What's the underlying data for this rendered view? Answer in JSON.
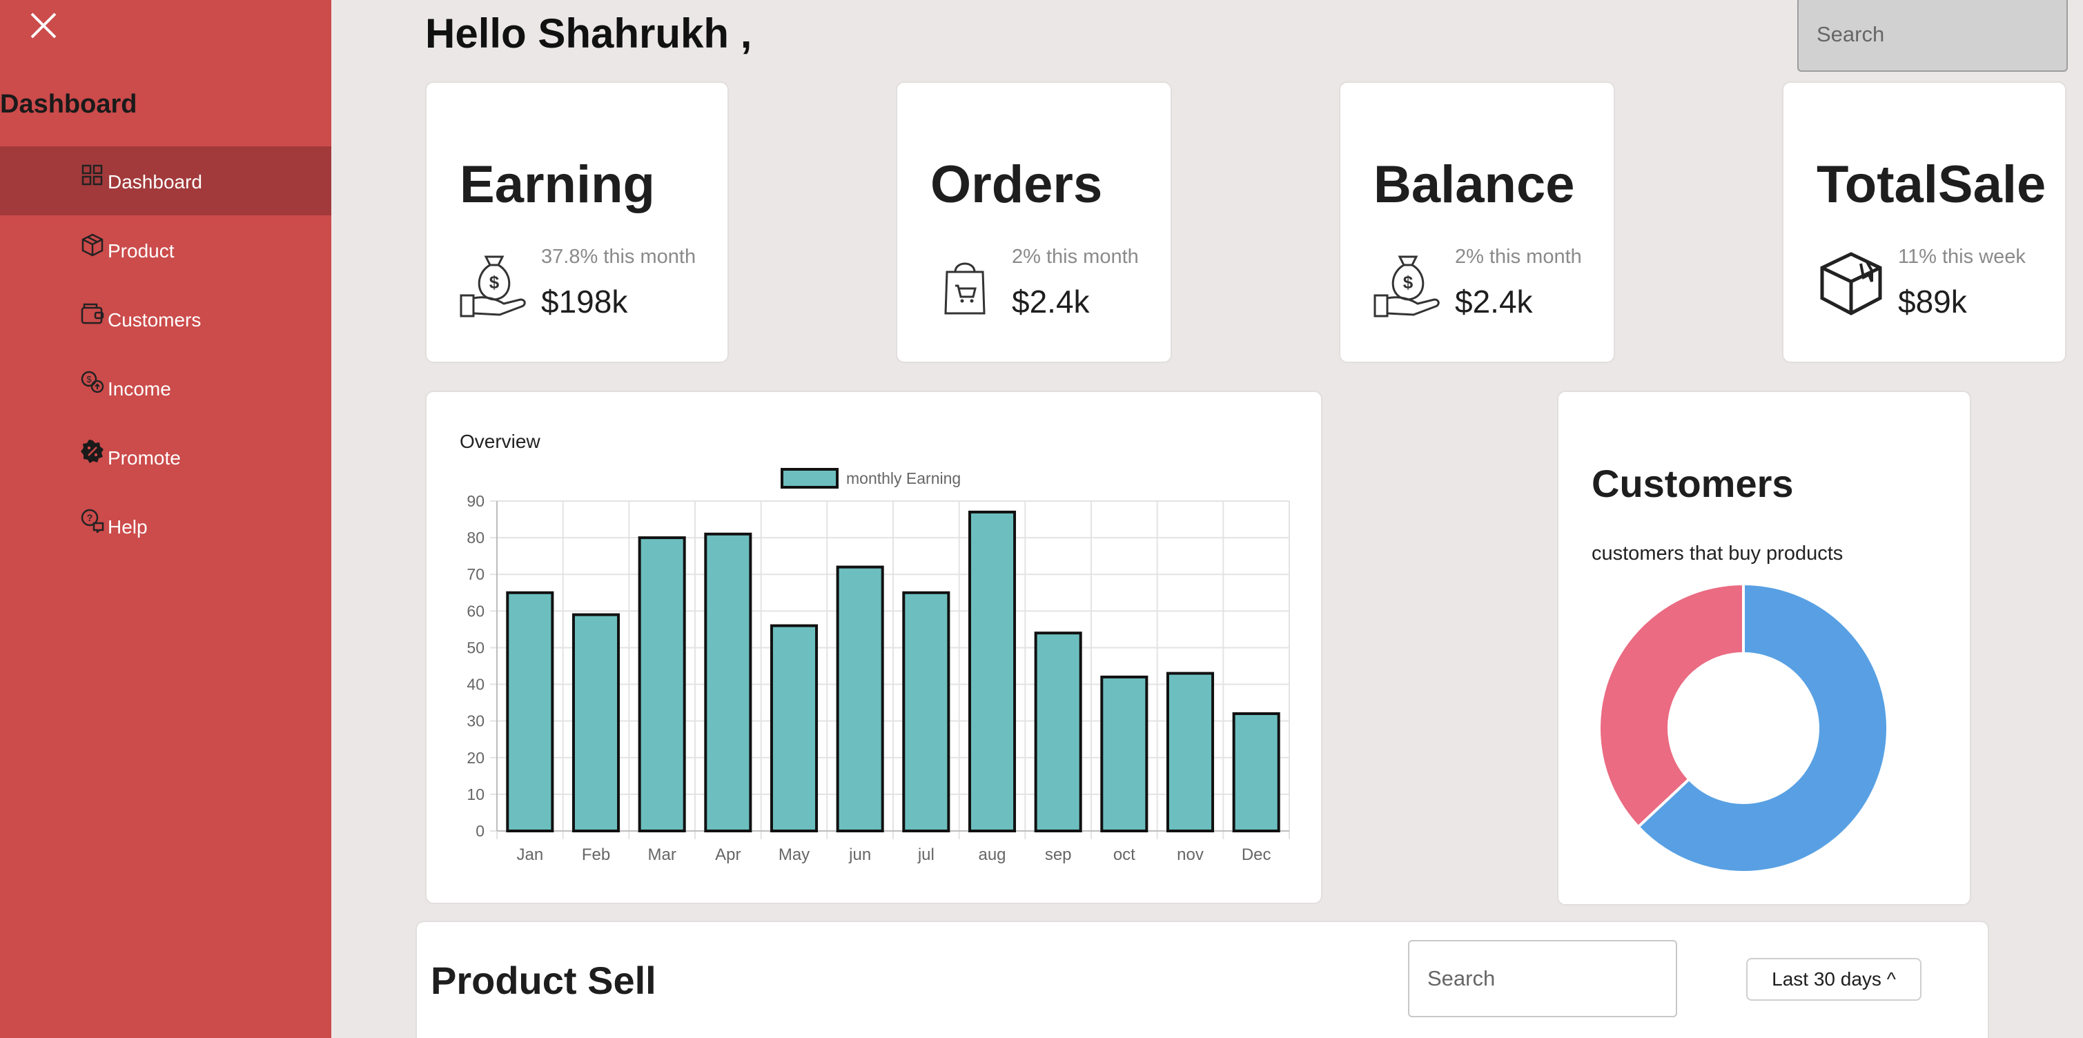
{
  "sidebar": {
    "brand": "Dashboard",
    "items": [
      {
        "label": "Dashboard",
        "icon": "grid-icon"
      },
      {
        "label": "Product",
        "icon": "box-icon"
      },
      {
        "label": "Customers",
        "icon": "wallet-icon"
      },
      {
        "label": "Income",
        "icon": "coins-icon"
      },
      {
        "label": "Promote",
        "icon": "badge-percent-icon"
      },
      {
        "label": "Help",
        "icon": "help-chat-icon"
      }
    ],
    "active_index": 0,
    "colors": {
      "background": "#cc4b4b",
      "active": "#a23a3b"
    }
  },
  "header": {
    "greeting": "Hello Shahrukh ,",
    "search_placeholder": "Search"
  },
  "stats": [
    {
      "title": "Earning",
      "sub": "37.8% this month",
      "value": "$198k",
      "icon": "money-bag-hand-icon"
    },
    {
      "title": "Orders",
      "sub": "2% this month",
      "value": "$2.4k",
      "icon": "shopping-bag-icon"
    },
    {
      "title": "Balance",
      "sub": "2% this month",
      "value": "$2.4k",
      "icon": "money-bag-hand-icon"
    },
    {
      "title": "TotalSale",
      "sub": "11% this week",
      "value": "$89k",
      "icon": "package-icon"
    }
  ],
  "overview": {
    "title": "Overview"
  },
  "chart_data": {
    "type": "bar",
    "title": "Overview",
    "categories": [
      "Jan",
      "Feb",
      "Mar",
      "Apr",
      "May",
      "jun",
      "jul",
      "aug",
      "sep",
      "oct",
      "nov",
      "Dec"
    ],
    "series": [
      {
        "name": "monthly Earning",
        "values": [
          65,
          59,
          80,
          81,
          56,
          72,
          65,
          87,
          54,
          42,
          43,
          32
        ],
        "color": "#6dbfbf"
      }
    ],
    "yticks": [
      0,
      10,
      20,
      30,
      40,
      50,
      60,
      70,
      80,
      90
    ],
    "ylim": [
      0,
      90
    ],
    "grid": true,
    "legend": "top"
  },
  "customers": {
    "title": "Customers",
    "subtitle": "customers that buy products",
    "donut": {
      "values": [
        63,
        37
      ],
      "colors": [
        "#58a0e3",
        "#ea6b82"
      ]
    }
  },
  "product_sell": {
    "title": "Product Sell",
    "search_placeholder": "Search",
    "filter_label": "Last 30 days ^"
  }
}
